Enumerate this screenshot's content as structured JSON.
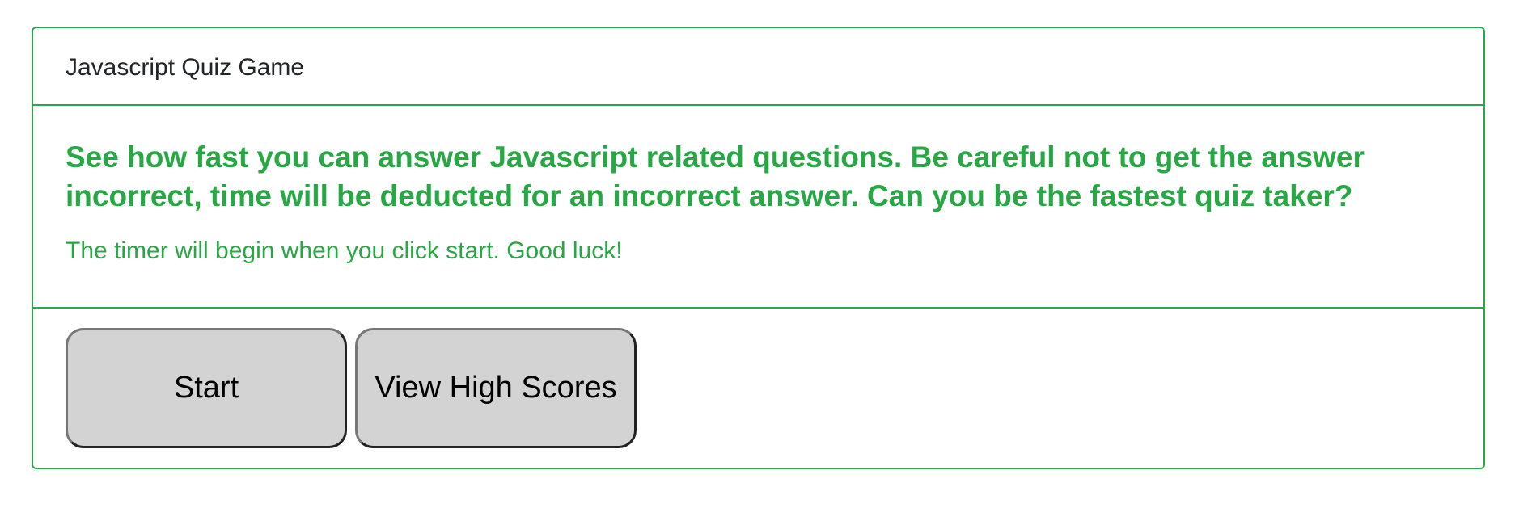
{
  "header": {
    "title": "Javascript Quiz Game"
  },
  "intro": {
    "lead": "See how fast you can answer Javascript related questions. Be careful not to get the answer incorrect, time will be deducted for an incorrect answer. Can you be the fastest quiz taker?",
    "note": "The timer will begin when you click start. Good luck!"
  },
  "actions": {
    "start_label": "Start",
    "high_scores_label": "View High Scores"
  },
  "colors": {
    "accent": "#28a745",
    "button_bg": "#d3d3d3",
    "header_text": "#212529"
  }
}
